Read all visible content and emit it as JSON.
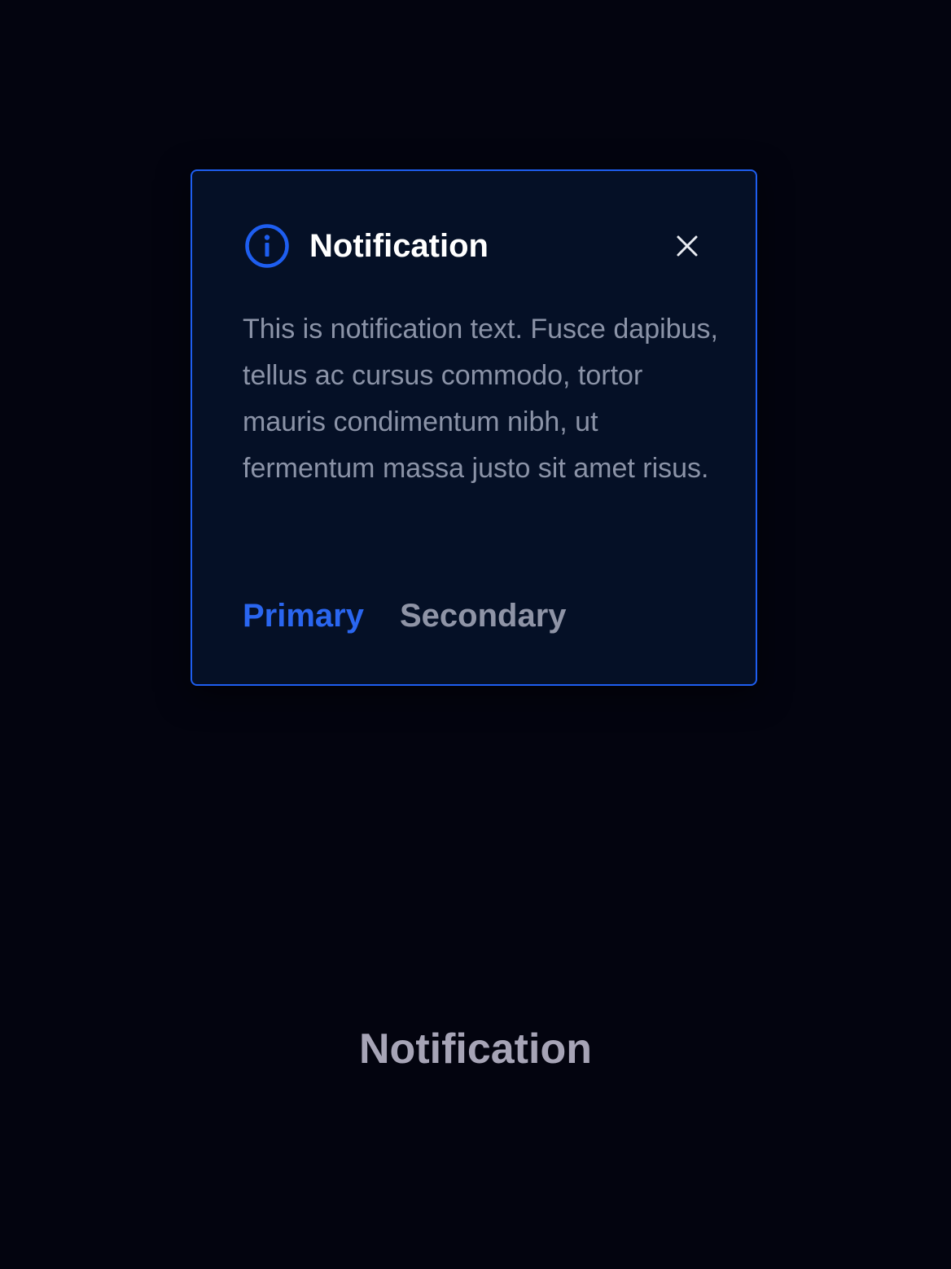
{
  "notification": {
    "title": "Notification",
    "body": "This is notification text. Fusce dapibus, tellus ac cursus commodo, tortor mauris condimentum nibh, ut fermentum massa justo sit amet risus.",
    "primary_label": "Primary",
    "secondary_label": "Secondary",
    "icon": "info-icon",
    "close_icon": "close-icon"
  },
  "caption": "Notification",
  "colors": {
    "background": "#03040f",
    "card_background": "#051026",
    "accent": "#1e5ef0",
    "title": "#ffffff",
    "body_text": "#8b93a7",
    "secondary": "#8f94a6",
    "caption": "#a6a4b6"
  }
}
